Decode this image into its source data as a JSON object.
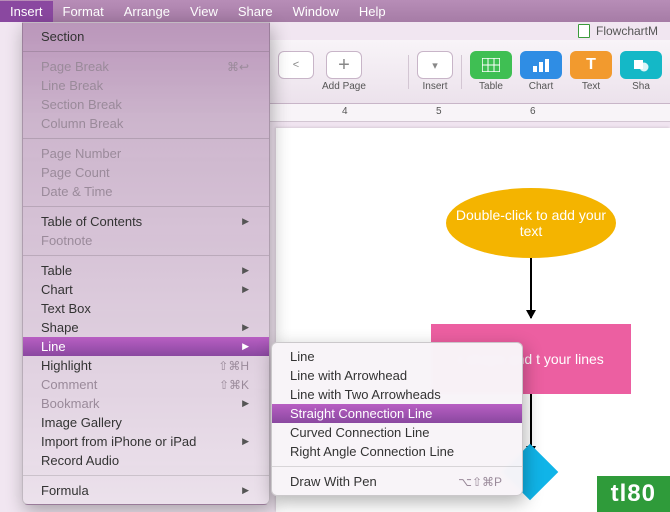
{
  "menubar": {
    "items": [
      "Insert",
      "Format",
      "Arrange",
      "View",
      "Share",
      "Window",
      "Help"
    ],
    "active_index": 0
  },
  "document_title": "FlowchartM",
  "document_path_short": "Flowchart",
  "toolbar": {
    "prev": "<",
    "add_page": "Add Page",
    "insert": "Insert",
    "table": "Table",
    "chart": "Chart",
    "text": "Text",
    "shape": "Sha",
    "text_glyph": "T"
  },
  "ruler": {
    "marks": [
      "4",
      "5",
      "6"
    ]
  },
  "canvas": {
    "oval_text": "Double-click to add your text",
    "rect_text_visible": "r shape and t your lines"
  },
  "menu_main": [
    {
      "label": "Section",
      "type": "item"
    },
    {
      "type": "sep"
    },
    {
      "label": "Page Break",
      "shortcut": "⌘↩",
      "dim": true
    },
    {
      "label": "Line Break",
      "dim": true
    },
    {
      "label": "Section Break",
      "dim": true
    },
    {
      "label": "Column Break",
      "dim": true
    },
    {
      "type": "sep"
    },
    {
      "label": "Page Number",
      "dim": true
    },
    {
      "label": "Page Count",
      "dim": true
    },
    {
      "label": "Date & Time",
      "dim": true
    },
    {
      "type": "sep"
    },
    {
      "label": "Table of Contents",
      "submenu": true
    },
    {
      "label": "Footnote",
      "dim": true
    },
    {
      "type": "sep"
    },
    {
      "label": "Table",
      "submenu": true
    },
    {
      "label": "Chart",
      "submenu": true
    },
    {
      "label": "Text Box"
    },
    {
      "label": "Shape",
      "submenu": true
    },
    {
      "label": "Line",
      "submenu": true,
      "selected": true
    },
    {
      "label": "Highlight",
      "shortcut": "⇧⌘H"
    },
    {
      "label": "Comment",
      "shortcut": "⇧⌘K",
      "dim": true
    },
    {
      "label": "Bookmark",
      "submenu": true,
      "dim": true
    },
    {
      "label": "Image Gallery"
    },
    {
      "label": "Import from iPhone or iPad",
      "submenu": true
    },
    {
      "label": "Record Audio"
    },
    {
      "type": "sep"
    },
    {
      "label": "Formula",
      "submenu": true
    }
  ],
  "menu_sub": [
    {
      "label": "Line"
    },
    {
      "label": "Line with Arrowhead"
    },
    {
      "label": "Line with Two Arrowheads"
    },
    {
      "label": "Straight Connection Line",
      "selected": true
    },
    {
      "label": "Curved Connection Line"
    },
    {
      "label": "Right Angle Connection Line"
    },
    {
      "type": "sep"
    },
    {
      "label": "Draw With Pen",
      "shortcut": "⌥⇧⌘P"
    }
  ],
  "watermark": "tl80"
}
